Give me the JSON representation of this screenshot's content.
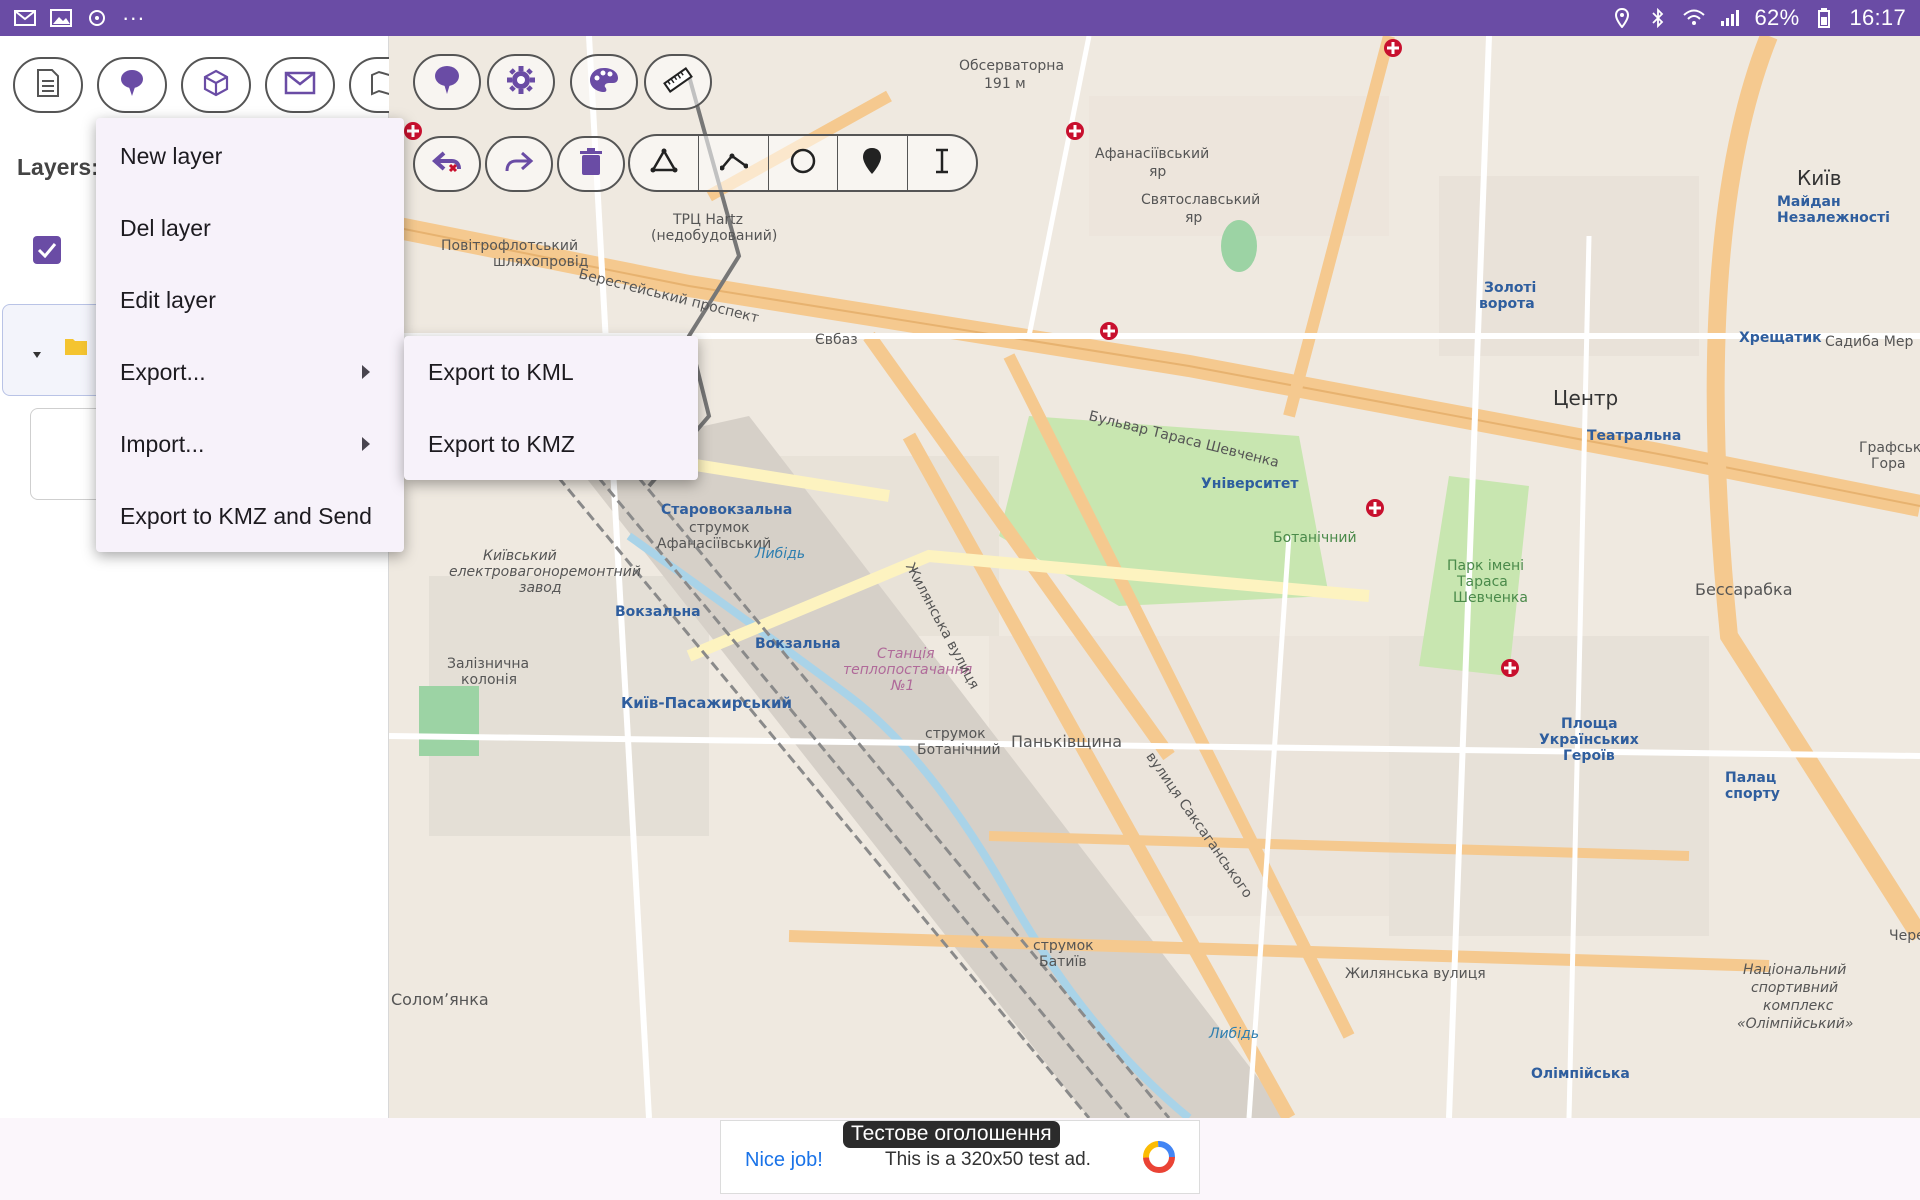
{
  "status_bar": {
    "icons_left": [
      "mail-icon",
      "image-icon",
      "sync-icon",
      "more-icon"
    ],
    "more": "···",
    "icons_right": [
      "location-icon",
      "bluetooth-icon",
      "wifi-icon",
      "signal-icon",
      "battery-icon"
    ],
    "battery": "62%",
    "time": "16:17"
  },
  "left_panel": {
    "toolbar": [
      "document-icon",
      "marker-icon",
      "box-icon",
      "mail-icon",
      "map-icon"
    ],
    "layers_label": "Layers:",
    "layer_checked": true
  },
  "map_toolbar": {
    "top_row": [
      "marker-icon",
      "gear-icon",
      "palette-icon",
      "ruler-icon"
    ],
    "second_row": [
      "undo-icon",
      "redo-icon",
      "trash-icon"
    ],
    "draw_tools": [
      "polygon-icon",
      "polyline-icon",
      "circle-icon",
      "pin-icon",
      "text-icon"
    ]
  },
  "menu": {
    "items": [
      {
        "label": "New layer",
        "has_submenu": false
      },
      {
        "label": "Del layer",
        "has_submenu": false
      },
      {
        "label": "Edit layer",
        "has_submenu": false
      },
      {
        "label": "Export...",
        "has_submenu": true
      },
      {
        "label": "Import...",
        "has_submenu": true
      },
      {
        "label": "Export to KMZ and Send",
        "has_submenu": false
      }
    ]
  },
  "submenu": {
    "items": [
      {
        "label": "Export to KML"
      },
      {
        "label": "Export to KMZ"
      }
    ]
  },
  "map_labels": {
    "l1": "Обсерваторна",
    "l2": "191 м",
    "l3": "Афанасіївський",
    "l4": "яр",
    "l5": "Святославський",
    "l6": "яр",
    "l7": "Київ",
    "l8": "Майдан",
    "l9": "Незалежності",
    "l10": "Золоті",
    "l11": "ворота",
    "l12": "Хрещатик",
    "l13": "Садиба Мер",
    "l14": "Центр",
    "l15": "Театральна",
    "l16": "Графська",
    "l17": "Гора",
    "l18": "ТРЦ Hartz",
    "l19": "(недобудований)",
    "l20": "Повітрофлотський",
    "l21": "шляхопровід",
    "l22": "Берестейський проспект",
    "l23": "Євбаз",
    "l24": "Бульвар Тараса Шевченка",
    "l25": "Університет",
    "l26": "Ботанічний",
    "l27": "Парк імені",
    "l28": "Тараса",
    "l29": "Шевченка",
    "l30": "Бессарабка",
    "l31": "Старовокзальна",
    "l32": "струмок",
    "l33": "Афанасіївський",
    "l34": "Київський",
    "l35": "електровагоноремонтний",
    "l36": "завод",
    "l37": "Вокзальна",
    "l38": "Вокзальна",
    "l39": "Залізнична",
    "l40": "колонія",
    "l41": "Київ-Пасажирський",
    "l42": "Станція",
    "l43": "теплопостачання",
    "l44": "№1",
    "l45": "струмок",
    "l46": "Ботанічний",
    "l47": "Паньківщина",
    "l48": "Площа",
    "l49": "Українських",
    "l50": "Героїв",
    "l51": "Палац",
    "l52": "спорту",
    "l53": "Жилянська вулиця",
    "l54": "Національний",
    "l55": "спортивний",
    "l56": "комплекс",
    "l57": "«Олімпійський»",
    "l58": "Олімпійська",
    "l59": "струмок",
    "l60": "Батиїв",
    "l61": "Либідь",
    "l62": "вулиця Саксаганського",
    "l63": "Жилянська вулиця",
    "l64": "Соломʼянка",
    "l65": "Черепа",
    "l66": "Либідь"
  },
  "ad": {
    "nice": "Nice job!",
    "tag": "Тестове оголошення",
    "text": "This is a 320x50 test ad."
  },
  "colors": {
    "status_bar": "#6a4ca5",
    "accent": "#6a4ca5",
    "menu_bg": "#f7f2fa",
    "map_bg": "#efe9e0",
    "park": "#c8e6b0",
    "road_major": "#f5c98f",
    "road_minor": "#ffffff",
    "rail": "#8a8a8a",
    "water": "#a9d3e8"
  }
}
